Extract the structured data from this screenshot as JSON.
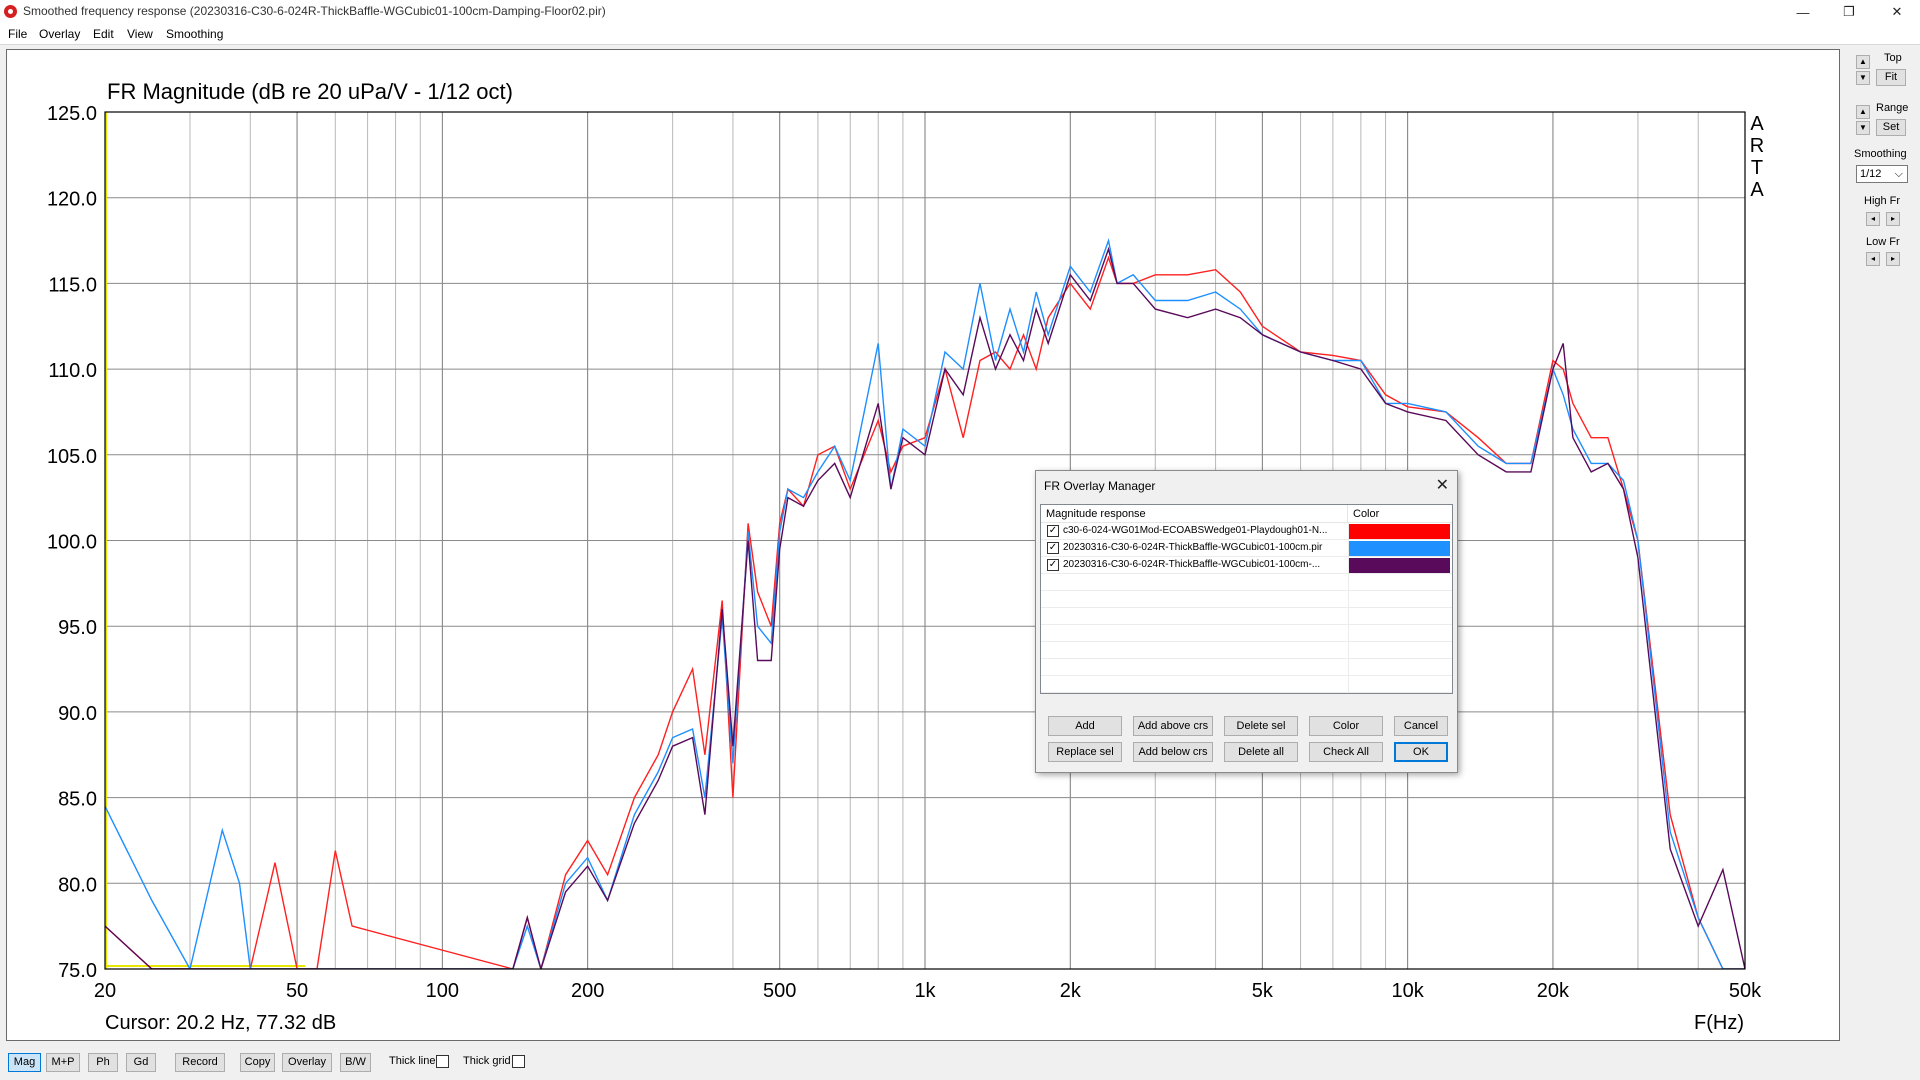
{
  "window": {
    "title": "Smoothed frequency response (20230316-C30-6-024R-ThickBaffle-WGCubic01-100cm-Damping-Floor02.pir)",
    "minimize": "—",
    "restore": "❐",
    "close": "✕"
  },
  "menu": [
    "File",
    "Overlay",
    "Edit",
    "View",
    "Smoothing"
  ],
  "plot": {
    "title": "FR Magnitude (dB re 20 uPa/V - 1/12 oct)",
    "watermark": "ARTA",
    "cursor": "Cursor: 20.2 Hz, 77.32 dB",
    "xunit": "F(Hz)"
  },
  "right_panel": {
    "top_label": "Top",
    "fit": "Fit",
    "range_label": "Range",
    "set": "Set",
    "smoothing_label": "Smoothing",
    "smoothing_value": "1/12",
    "high_fr": "High Fr",
    "low_fr": "Low Fr",
    "up": "▲",
    "down": "▼",
    "left": "◂",
    "right": "▸",
    "dropdown": "⌵"
  },
  "bottom_bar": {
    "buttons": [
      "Mag",
      "M+P",
      "Ph",
      "Gd",
      "Record",
      "Copy",
      "Overlay",
      "B/W"
    ],
    "active": "Mag",
    "thick_line": "Thick line",
    "thick_grid": "Thick grid"
  },
  "dialog": {
    "title": "FR Overlay Manager",
    "close": "✕",
    "col_name": "Magnitude response",
    "col_color": "Color",
    "rows": [
      {
        "name": "c30-6-024-WG01Mod-ECOABSWedge01-Playdough01-N...",
        "color": "#ff0000",
        "checked": "✓"
      },
      {
        "name": "20230316-C30-6-024R-ThickBaffle-WGCubic01-100cm.pir",
        "color": "#1e90ff",
        "checked": "✓"
      },
      {
        "name": "20230316-C30-6-024R-ThickBaffle-WGCubic01-100cm-...",
        "color": "#5a0a5a",
        "checked": "✓"
      }
    ],
    "buttons": [
      "Add",
      "Add above crs",
      "Delete sel",
      "Color",
      "Cancel",
      "Replace sel",
      "Add below crs",
      "Delete all",
      "Check All",
      "OK"
    ]
  },
  "chart_data": {
    "type": "line",
    "title": "FR Magnitude (dB re 20 uPa/V - 1/12 oct)",
    "xlabel": "F(Hz)",
    "ylabel": "",
    "xscale": "log",
    "xlim": [
      20,
      50000
    ],
    "ylim": [
      75,
      125
    ],
    "xticks": [
      20,
      50,
      100,
      200,
      500,
      1000,
      2000,
      5000,
      10000,
      20000,
      50000
    ],
    "xtick_labels": [
      "20",
      "50",
      "100",
      "200",
      "500",
      "1k",
      "2k",
      "5k",
      "10k",
      "20k",
      "50k"
    ],
    "yticks": [
      75,
      80,
      85,
      90,
      95,
      100,
      105,
      110,
      115,
      120,
      125
    ],
    "ytick_labels": [
      "75.0",
      "80.0",
      "85.0",
      "90.0",
      "95.0",
      "100.0",
      "105.0",
      "110.0",
      "115.0",
      "120.0",
      "125.0"
    ],
    "grid": true,
    "series": [
      {
        "color": "#ff2020",
        "x": [
          20,
          25,
          30,
          40,
          45,
          50,
          55,
          60,
          65,
          140,
          150,
          160,
          180,
          200,
          220,
          250,
          280,
          300,
          330,
          350,
          380,
          400,
          430,
          450,
          480,
          500,
          520,
          560,
          600,
          650,
          700,
          800,
          850,
          900,
          1000,
          1100,
          1200,
          1300,
          1400,
          1500,
          1600,
          1700,
          1800,
          2000,
          2200,
          2400,
          2500,
          2700,
          3000,
          3500,
          4000,
          4500,
          5000,
          6000,
          7000,
          8000,
          9000,
          10000,
          12000,
          14000,
          16000,
          18000,
          20000,
          21000,
          22000,
          24000,
          26000,
          28000,
          30000,
          35000,
          40000,
          45000,
          50000
        ],
        "y": [
          77.5,
          75,
          75,
          75,
          81.2,
          75,
          75,
          81.9,
          77.5,
          75,
          78,
          75,
          80.5,
          82.5,
          80.5,
          85,
          87.5,
          90,
          92.5,
          87.5,
          96.5,
          85,
          101,
          97,
          95,
          101,
          103,
          102,
          105,
          105.5,
          103,
          107,
          104,
          105.5,
          106,
          110,
          106,
          110.5,
          111,
          110,
          112,
          110,
          113,
          115,
          113.5,
          116.5,
          115,
          115,
          115.5,
          115.5,
          115.8,
          114.5,
          112.5,
          111,
          110.8,
          110.5,
          108.5,
          107.8,
          107.5,
          106,
          104.5,
          104.5,
          110.5,
          110,
          108,
          106,
          106,
          103,
          100,
          84,
          78,
          75,
          75
        ]
      },
      {
        "color": "#1e8fff",
        "x": [
          20,
          25,
          30,
          35,
          38,
          40,
          45,
          50,
          140,
          150,
          160,
          180,
          200,
          220,
          250,
          280,
          300,
          330,
          350,
          380,
          400,
          430,
          450,
          480,
          500,
          520,
          560,
          600,
          650,
          700,
          800,
          850,
          900,
          1000,
          1100,
          1200,
          1300,
          1400,
          1500,
          1600,
          1700,
          1800,
          2000,
          2200,
          2400,
          2500,
          2700,
          3000,
          3500,
          4000,
          4500,
          5000,
          6000,
          7000,
          8000,
          9000,
          10000,
          12000,
          14000,
          16000,
          18000,
          20000,
          21000,
          22000,
          24000,
          26000,
          28000,
          30000,
          35000,
          40000,
          45000,
          50000
        ],
        "y": [
          84.5,
          79,
          75,
          83.1,
          80,
          75,
          75,
          75,
          75,
          77.5,
          75,
          80,
          81.5,
          79,
          84,
          86.5,
          88.5,
          89,
          85,
          95.5,
          87,
          100.5,
          95,
          94,
          100.5,
          103,
          102.5,
          104,
          105.5,
          103.5,
          111.5,
          103,
          106.5,
          105.5,
          111,
          110,
          115,
          110.5,
          113.5,
          111,
          114.5,
          112,
          116,
          114.5,
          117.5,
          115,
          115.5,
          114,
          114,
          114.5,
          113.5,
          112,
          111,
          110.5,
          110.5,
          108,
          108,
          107.5,
          105.5,
          104.5,
          104.5,
          110,
          108.5,
          106.5,
          104.5,
          104.5,
          103.5,
          100,
          83,
          78,
          75,
          75
        ]
      },
      {
        "color": "#5a0a5a",
        "x": [
          20,
          25,
          30,
          140,
          150,
          160,
          180,
          200,
          220,
          250,
          280,
          300,
          330,
          350,
          380,
          400,
          430,
          450,
          480,
          500,
          520,
          560,
          600,
          650,
          700,
          800,
          850,
          900,
          1000,
          1100,
          1200,
          1300,
          1400,
          1500,
          1600,
          1700,
          1800,
          2000,
          2200,
          2400,
          2500,
          2700,
          3000,
          3500,
          4000,
          4500,
          5000,
          6000,
          7000,
          8000,
          9000,
          10000,
          12000,
          14000,
          16000,
          18000,
          20000,
          21000,
          22000,
          24000,
          26000,
          28000,
          30000,
          35000,
          40000,
          45000,
          50000
        ],
        "y": [
          77.5,
          75,
          75,
          75,
          78,
          75,
          79.5,
          81,
          79,
          83.5,
          86,
          88,
          88.5,
          84,
          96,
          88,
          100,
          93,
          93,
          99.5,
          102.5,
          102,
          103.5,
          104.5,
          102.5,
          108,
          103,
          106,
          105,
          110,
          108.5,
          113,
          110,
          112,
          110.5,
          113.5,
          111.5,
          115.5,
          114,
          117,
          115,
          115,
          113.5,
          113,
          113.5,
          113,
          112,
          111,
          110.5,
          110,
          108,
          107.5,
          107,
          105,
          104,
          104,
          110,
          111.5,
          106,
          104,
          104.5,
          103,
          99,
          82,
          77.5,
          80.8,
          75
        ]
      }
    ]
  }
}
